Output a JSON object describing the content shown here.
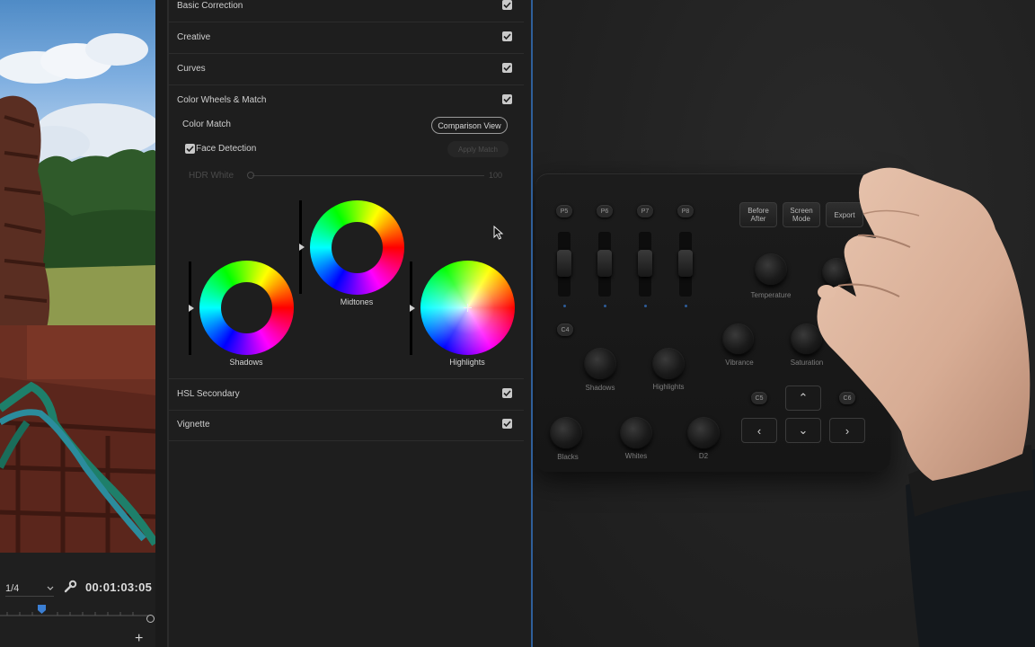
{
  "monitor": {
    "fraction": "1/4",
    "timecode": "00:01:03:05"
  },
  "lumetri": {
    "sections": {
      "basic_correction": "Basic Correction",
      "creative": "Creative",
      "curves": "Curves",
      "color_wheels": "Color Wheels & Match",
      "hsl_secondary": "HSL Secondary",
      "vignette": "Vignette"
    },
    "color_match": {
      "label": "Color Match",
      "comparison_view": "Comparison View",
      "face_detection": "Face Detection",
      "face_detection_checked": true,
      "apply_match": "Apply Match"
    },
    "hdr_white": {
      "label": "HDR White",
      "value": "100"
    },
    "wheels": {
      "shadows": "Shadows",
      "midtones": "Midtones",
      "highlights": "Highlights"
    }
  },
  "controller": {
    "pick_buttons": [
      "P5",
      "P6",
      "P7",
      "P8"
    ],
    "function_buttons": {
      "before_after_1": "Before",
      "before_after_2": "After",
      "screen_mode_1": "Screen",
      "screen_mode_2": "Mode",
      "export": "Export"
    },
    "c4": "C4",
    "c5": "C5",
    "c6": "C6",
    "knobs": {
      "temperature": "Temperature",
      "vibrance": "Vibrance",
      "saturation": "Saturation",
      "shadows": "Shadows",
      "highlights": "Highlights",
      "blacks": "Blacks",
      "whites": "Whites",
      "d2": "D2"
    },
    "arrows": {
      "up": "⌃",
      "left": "‹",
      "down": "⌄",
      "right": "›"
    }
  }
}
